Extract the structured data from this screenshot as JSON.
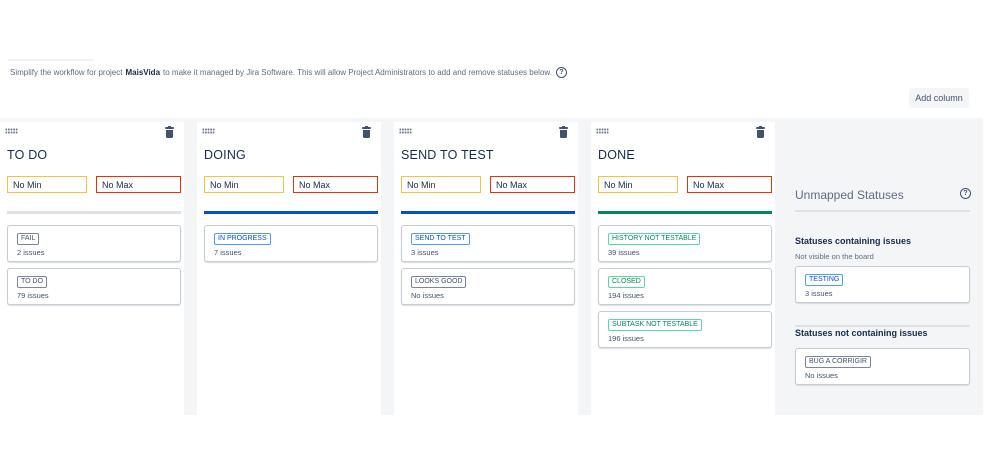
{
  "intro": {
    "prefix": "Simplify the workflow for project",
    "project": "MaisVida",
    "suffix": "to make it managed by Jira Software. This will allow Project Administrators to add and remove statuses below.",
    "help_icon": "?"
  },
  "add_column_label": "Add column",
  "colors": {
    "todo": "#dfe1e6",
    "in_progress": "#0052cc",
    "done": "#00875a",
    "min_border": "#f4c23c",
    "max_border": "#de350b"
  },
  "columns": [
    {
      "title": "TO DO",
      "min": "No Min",
      "max": "No Max",
      "cards": [
        {
          "status": "FAIL",
          "count": "2 issues"
        },
        {
          "status": "TO DO",
          "count": "79 issues"
        }
      ]
    },
    {
      "title": "DOING",
      "min": "No Min",
      "max": "No Max",
      "cards": [
        {
          "status": "IN PROGRESS",
          "count": "7 issues"
        }
      ]
    },
    {
      "title": "SEND TO TEST",
      "min": "No Min",
      "max": "No Max",
      "cards": [
        {
          "status": "SEND TO TEST",
          "count": "3 issues"
        },
        {
          "status": "LOOKS GOOD",
          "count": "No issues"
        }
      ]
    },
    {
      "title": "DONE",
      "min": "No Min",
      "max": "No Max",
      "cards": [
        {
          "status": "HISTORY NOT TESTABLE",
          "count": "39 issues"
        },
        {
          "status": "CLOSED",
          "count": "194 issues"
        },
        {
          "status": "SUBTASK NOT TESTABLE",
          "count": "196 issues"
        }
      ]
    }
  ],
  "unmapped": {
    "title": "Unmapped Statuses",
    "help_icon": "?",
    "with_issues": {
      "heading": "Statuses containing issues",
      "subtitle": "Not visible on the board",
      "cards": [
        {
          "status": "TESTING",
          "count": "3 issues"
        }
      ]
    },
    "without_issues": {
      "heading": "Statuses not containing issues",
      "cards": [
        {
          "status": "BUG A CORRIGIR",
          "count": "No issues"
        }
      ]
    }
  }
}
